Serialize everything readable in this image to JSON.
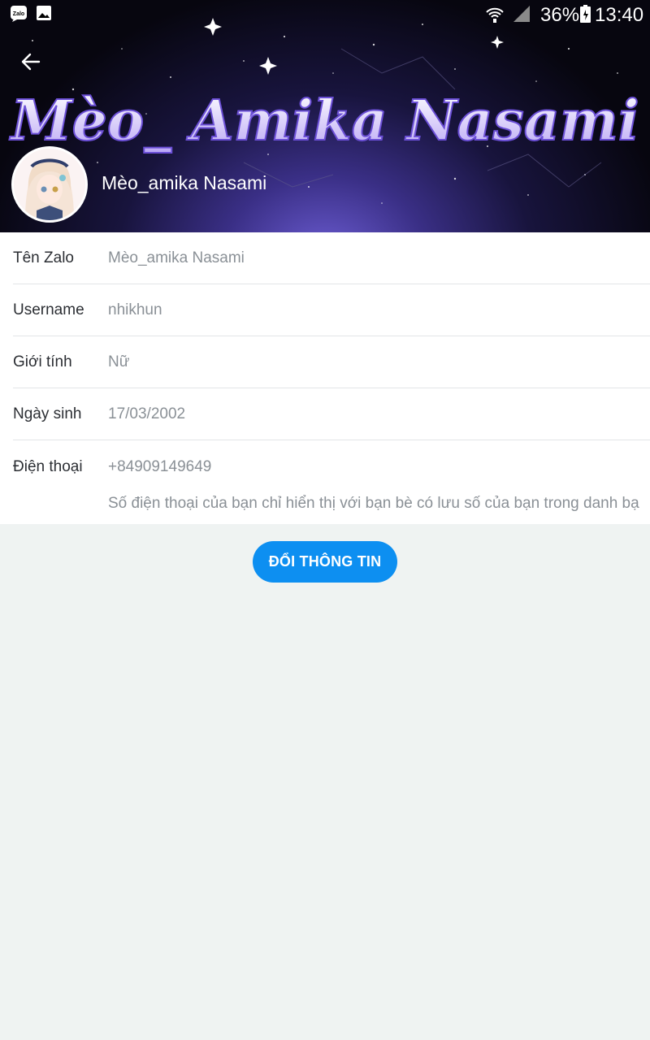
{
  "status_bar": {
    "battery": "36%",
    "time": "13:40",
    "icons": [
      "zalo-icon",
      "image-icon",
      "wifi-icon",
      "signal-icon",
      "battery-icon"
    ],
    "zalo_label": "Zalo"
  },
  "header": {
    "cover_title": "Mèo_ Amika Nasami",
    "display_name": "Mèo_amika Nasami"
  },
  "profile": {
    "rows": [
      {
        "label": "Tên Zalo",
        "value": "Mèo_amika Nasami"
      },
      {
        "label": "Username",
        "value": "nhikhun"
      },
      {
        "label": "Giới tính",
        "value": "Nữ"
      },
      {
        "label": "Ngày sinh",
        "value": "17/03/2002"
      },
      {
        "label": "Điện thoại",
        "value": "+84909149649"
      }
    ],
    "phone_note": "Số điện thoại của bạn chỉ hiển thị với bạn bè có lưu số của bạn trong danh bạ"
  },
  "actions": {
    "edit_label": "ĐỔI THÔNG TIN"
  },
  "colors": {
    "accent": "#0d8ff1",
    "background": "#eff3f2",
    "label": "#2b2e33",
    "value": "#8a9096"
  }
}
